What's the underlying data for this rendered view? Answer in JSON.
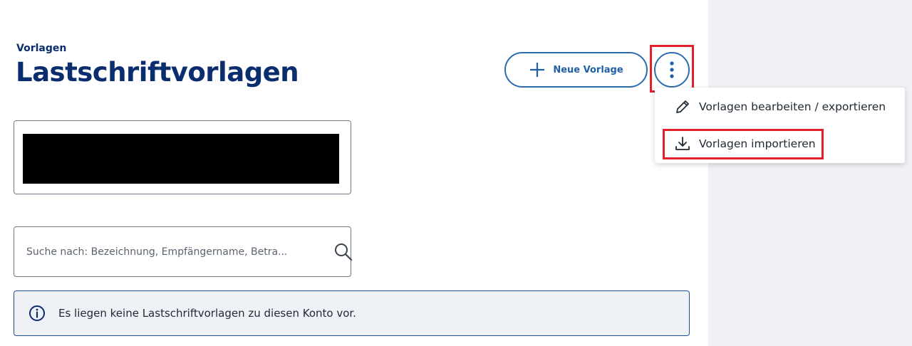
{
  "header": {
    "breadcrumb": "Vorlagen",
    "title": "Lastschriftvorlagen"
  },
  "actions": {
    "new_template_label": "Neue Vorlage"
  },
  "more_menu": {
    "items": [
      {
        "label": "Vorlagen bearbeiten / exportieren",
        "icon": "pencil-icon"
      },
      {
        "label": "Vorlagen importieren",
        "icon": "download-icon"
      }
    ]
  },
  "search": {
    "placeholder": "Suche nach: Bezeichnung, Empfängername, Betra...",
    "value": ""
  },
  "info": {
    "message": "Es liegen keine Lastschriftvorlagen zu diesen Konto vor."
  },
  "colors": {
    "brand_navy": "#0a2d6e",
    "accent_blue": "#2b6cae",
    "highlight_red": "#e0202a",
    "side_panel": "#eff1f5",
    "info_bg": "#eef1f6"
  }
}
